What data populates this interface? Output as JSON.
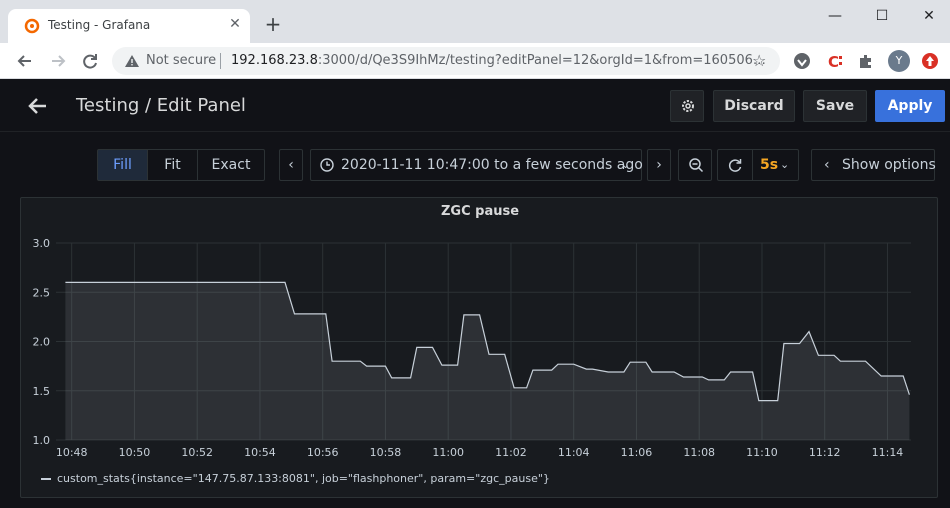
{
  "browser": {
    "tab_title": "Testing - Grafana",
    "security_label": "Not secure",
    "url_host": "192.168.23.8",
    "url_rest": ":3000/d/Qe3S9IhMz/testing?editPanel=12&orgId=1&from=160506…",
    "avatar_letter": "Y"
  },
  "header": {
    "title": "Testing / Edit Panel",
    "discard_label": "Discard",
    "save_label": "Save",
    "apply_label": "Apply"
  },
  "toolbar": {
    "fill_label": "Fill",
    "fit_label": "Fit",
    "exact_label": "Exact",
    "time_range": "2020-11-11 10:47:00 to a few seconds ago",
    "refresh_interval": "5s",
    "show_options_label": "Show options"
  },
  "colors": {
    "accent": "#3871dc",
    "series": "#c7d0d9",
    "refresh": "#f5a623"
  },
  "chart_data": {
    "type": "area",
    "title": "ZGC pause",
    "xlabel": "",
    "ylabel": "",
    "ylim": [
      1.0,
      3.0
    ],
    "yticks": [
      "1.0",
      "1.5",
      "2.0",
      "2.5",
      "3.0"
    ],
    "xticks": [
      "10:48",
      "10:50",
      "10:52",
      "10:54",
      "10:56",
      "10:58",
      "11:00",
      "11:02",
      "11:04",
      "11:06",
      "11:08",
      "11:10",
      "11:12",
      "11:14"
    ],
    "xrange_minutes": [
      47.5,
      74.75
    ],
    "grid": true,
    "legend_position": "bottom-left",
    "series": [
      {
        "name": "custom_stats{instance=\"147.75.87.133:8081\", job=\"flashphoner\", param=\"zgc_pause\"}",
        "x": [
          47.8,
          54.8,
          55.1,
          56.1,
          56.3,
          57.2,
          57.4,
          58.0,
          58.2,
          58.8,
          59.0,
          59.5,
          59.8,
          60.3,
          60.5,
          61.0,
          61.3,
          61.8,
          62.1,
          62.5,
          62.7,
          63.3,
          63.5,
          64.0,
          64.4,
          64.6,
          65.1,
          65.6,
          65.8,
          66.3,
          66.5,
          67.2,
          67.5,
          68.1,
          68.3,
          68.8,
          69.0,
          69.7,
          69.9,
          70.5,
          70.7,
          71.2,
          71.5,
          71.8,
          72.0,
          72.3,
          72.5,
          73.0,
          73.3,
          73.8,
          74.0,
          74.3,
          74.5,
          74.7
        ],
        "y": [
          2.6,
          2.6,
          2.28,
          2.28,
          1.8,
          1.8,
          1.75,
          1.75,
          1.63,
          1.63,
          1.94,
          1.94,
          1.76,
          1.76,
          2.27,
          2.27,
          1.87,
          1.87,
          1.53,
          1.53,
          1.71,
          1.71,
          1.77,
          1.77,
          1.72,
          1.72,
          1.69,
          1.69,
          1.79,
          1.79,
          1.69,
          1.69,
          1.64,
          1.64,
          1.61,
          1.61,
          1.69,
          1.69,
          1.4,
          1.4,
          1.98,
          1.98,
          2.1,
          1.86,
          1.86,
          1.86,
          1.8,
          1.8,
          1.8,
          1.65,
          1.65,
          1.65,
          1.65,
          1.46
        ]
      }
    ]
  }
}
